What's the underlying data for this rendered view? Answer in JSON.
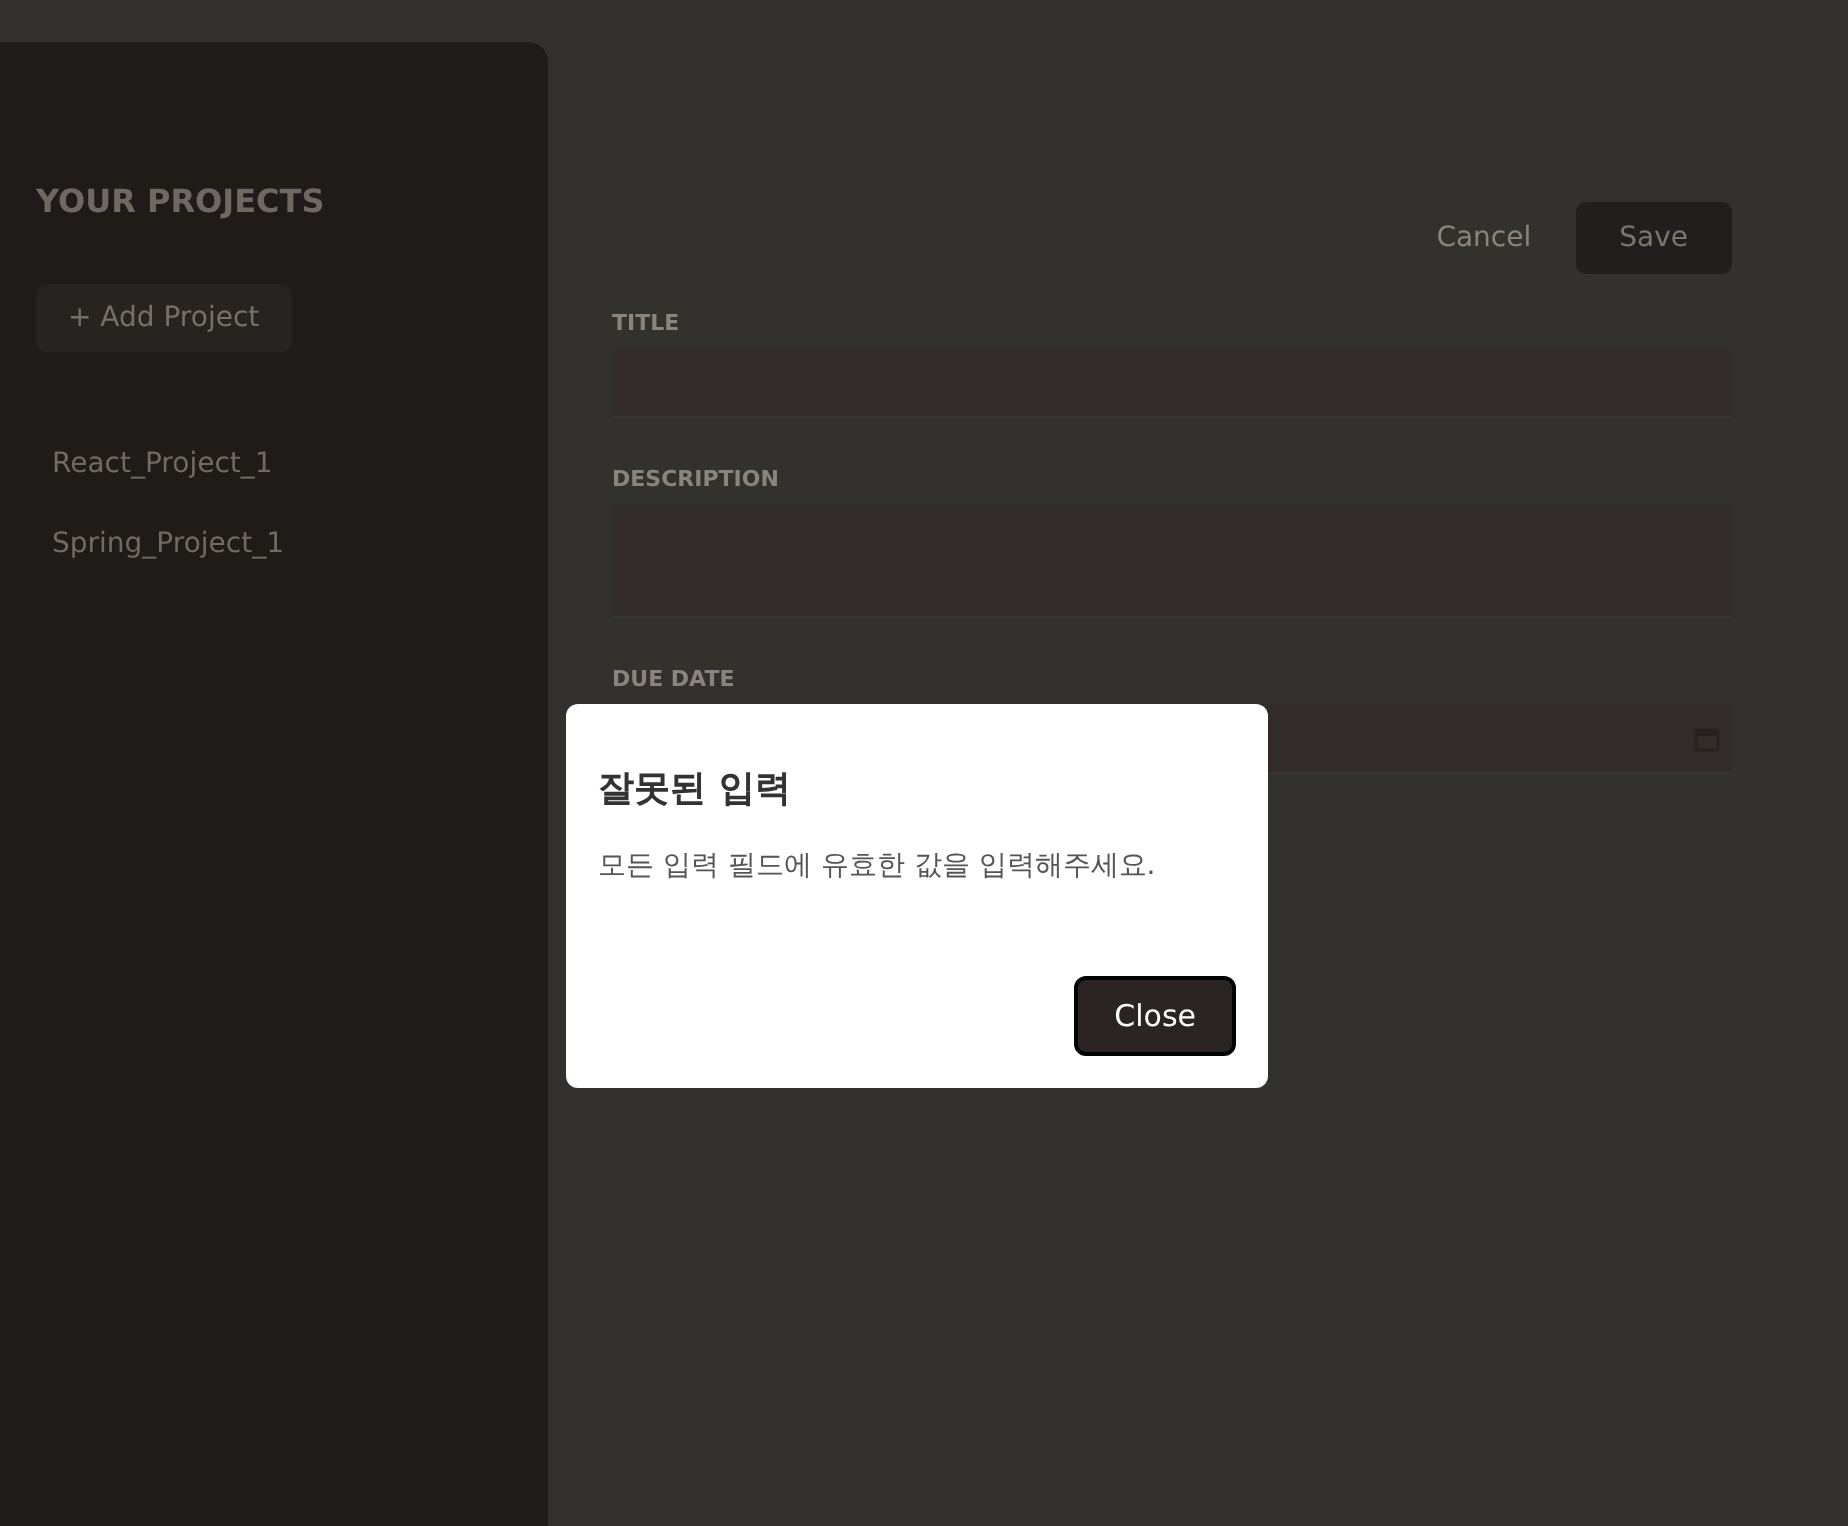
{
  "sidebar": {
    "heading": "YOUR PROJECTS",
    "add_button": "+ Add Project",
    "projects": [
      {
        "name": "React_Project_1",
        "selected": false
      },
      {
        "name": "Spring_Project_1",
        "selected": false
      }
    ]
  },
  "form": {
    "buttons": {
      "cancel": "Cancel",
      "save": "Save"
    },
    "fields": [
      {
        "label": "TITLE",
        "kind": "text"
      },
      {
        "label": "DESCRIPTION",
        "kind": "textarea"
      },
      {
        "label": "DUE DATE",
        "kind": "date"
      }
    ]
  },
  "dialog": {
    "title": "잘못된 입력",
    "message": "모든 입력 필드에 유효한 값을 입력해주세요.",
    "button": "Close"
  }
}
